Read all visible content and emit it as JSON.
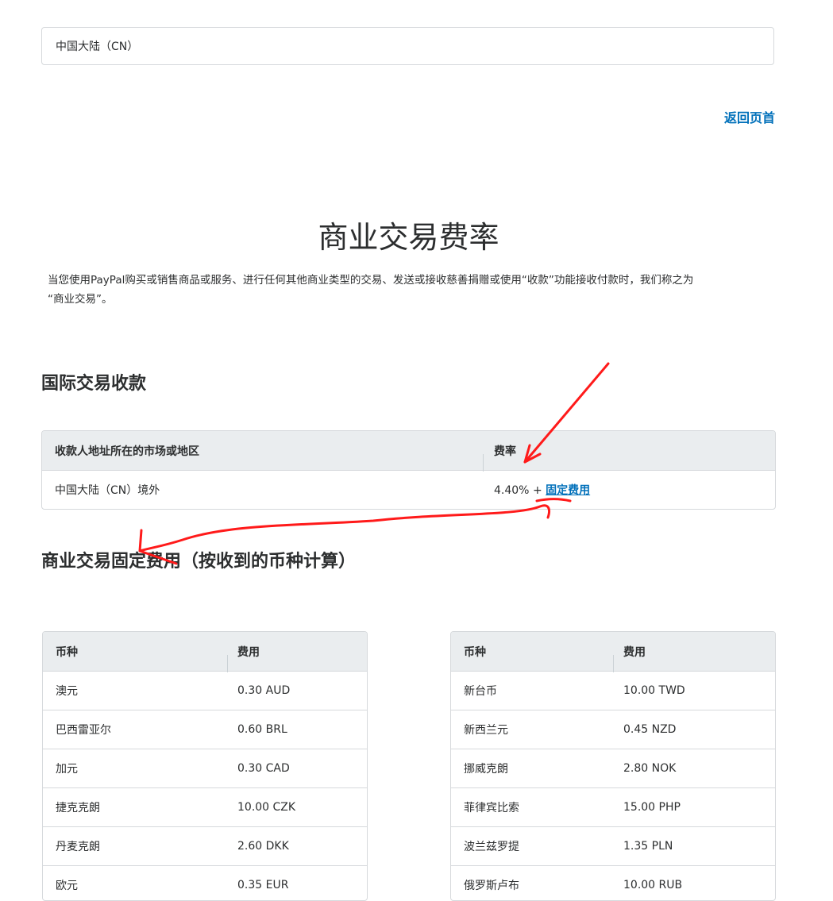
{
  "country_selector": {
    "value": "中国大陆（CN）"
  },
  "back_link": "返回页首",
  "page_title": "商业交易费率",
  "intro": {
    "line1": "当您使用PayPal购买或销售商品或服务、进行任何其他商业类型的交易、发送或接收慈善捐赠或使用“收款”功能接收付款时，我们称之为",
    "line2": "“商业交易”。"
  },
  "intl_section": {
    "heading": "国际交易收款",
    "headers": [
      "收款人地址所在的市场或地区",
      "费率"
    ],
    "row": {
      "region": "中国大陆（CN）境外",
      "rate": "4.40%",
      "plus": "+",
      "fixed_fee_link": "固定费用"
    }
  },
  "fixed_section": {
    "heading": "商业交易固定费用（按收到的币种计算）",
    "headers": [
      "币种",
      "费用"
    ],
    "left_table": [
      {
        "currency": "澳元",
        "fee": "0.30 AUD"
      },
      {
        "currency": "巴西雷亚尔",
        "fee": "0.60 BRL"
      },
      {
        "currency": "加元",
        "fee": "0.30 CAD"
      },
      {
        "currency": "捷克克朗",
        "fee": "10.00 CZK"
      },
      {
        "currency": "丹麦克朗",
        "fee": "2.60 DKK"
      },
      {
        "currency": "欧元",
        "fee": "0.35 EUR"
      }
    ],
    "right_table": [
      {
        "currency": "新台币",
        "fee": "10.00 TWD"
      },
      {
        "currency": "新西兰元",
        "fee": "0.45 NZD"
      },
      {
        "currency": "挪威克朗",
        "fee": "2.80 NOK"
      },
      {
        "currency": "菲律宾比索",
        "fee": "15.00 PHP"
      },
      {
        "currency": "波兰兹罗提",
        "fee": "1.35 PLN"
      },
      {
        "currency": "俄罗斯卢布",
        "fee": "10.00 RUB"
      }
    ]
  },
  "colors": {
    "link": "#0070ba",
    "annotation": "#ff1a1a",
    "table_header_bg": "#eaedef"
  }
}
